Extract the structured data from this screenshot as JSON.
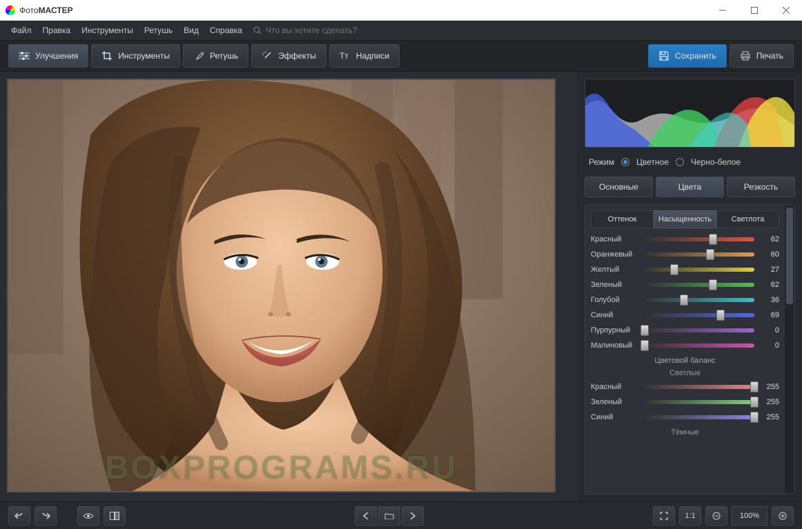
{
  "window": {
    "title_light": "Фото",
    "title_bold": "МАСТЕР"
  },
  "menu": {
    "items": [
      "Файл",
      "Правка",
      "Инструменты",
      "Ретушь",
      "Вид",
      "Справка"
    ],
    "search_placeholder": "Что вы хотите сделать?"
  },
  "toolbar": {
    "tabs": [
      {
        "label": "Улучшения",
        "icon": "sliders-icon",
        "active": true
      },
      {
        "label": "Инструменты",
        "icon": "crop-icon",
        "active": false
      },
      {
        "label": "Ретушь",
        "icon": "brush-icon",
        "active": false
      },
      {
        "label": "Эффекты",
        "icon": "wand-icon",
        "active": false
      },
      {
        "label": "Надписи",
        "icon": "text-icon",
        "active": false
      }
    ],
    "save_label": "Сохранить",
    "print_label": "Печать"
  },
  "side": {
    "mode_label": "Режим",
    "mode_color": "Цветное",
    "mode_bw": "Черно-белое",
    "tabs1": [
      {
        "label": "Основные",
        "active": false
      },
      {
        "label": "Цвета",
        "active": true
      },
      {
        "label": "Резкость",
        "active": false
      }
    ],
    "tabs2": [
      {
        "label": "Оттенок",
        "active": false
      },
      {
        "label": "Насыщенность",
        "active": true
      },
      {
        "label": "Светлота",
        "active": false
      }
    ],
    "sliders": [
      {
        "name": "Красный",
        "value": 62,
        "max": 100,
        "grad": "linear-gradient(90deg,#333,#d54)",
        "bar": "linear-gradient(90deg,#333,#e44)"
      },
      {
        "name": "Оранжевый",
        "value": 60,
        "max": 100,
        "grad": "linear-gradient(90deg,#333,#d95)",
        "bar": "linear-gradient(90deg,#333,#e85)"
      },
      {
        "name": "Желтый",
        "value": 27,
        "max": 100,
        "grad": "linear-gradient(90deg,#333,#dc4)",
        "bar": "linear-gradient(90deg,#333,#ed4)"
      },
      {
        "name": "Зеленый",
        "value": 62,
        "max": 100,
        "grad": "linear-gradient(90deg,#333,#5b5)",
        "bar": "linear-gradient(90deg,#333,#4c5)"
      },
      {
        "name": "Голубой",
        "value": 36,
        "max": 100,
        "grad": "linear-gradient(90deg,#333,#4bc)",
        "bar": "linear-gradient(90deg,#333,#3cd)"
      },
      {
        "name": "Синий",
        "value": 69,
        "max": 100,
        "grad": "linear-gradient(90deg,#333,#56d)",
        "bar": "linear-gradient(90deg,#333,#46e)"
      },
      {
        "name": "Пурпурный",
        "value": 0,
        "max": 100,
        "grad": "linear-gradient(90deg,#333,#96c)",
        "bar": "linear-gradient(90deg,#333,#a6d)"
      },
      {
        "name": "Малиновый",
        "value": 0,
        "max": 100,
        "grad": "linear-gradient(90deg,#333,#c5a)",
        "bar": "linear-gradient(90deg,#333,#d5b)"
      }
    ],
    "balance_header": "Цветовой баланс",
    "balance_light": "Светлые",
    "balance_dark": "Тёмные",
    "balance_sliders": [
      {
        "name": "Красный",
        "value": 255,
        "max": 255,
        "grad": "linear-gradient(90deg,#333,#d88)"
      },
      {
        "name": "Зеленый",
        "value": 255,
        "max": 255,
        "grad": "linear-gradient(90deg,#333,#8c8)"
      },
      {
        "name": "Синий",
        "value": 255,
        "max": 255,
        "grad": "linear-gradient(90deg,#333,#88d)"
      }
    ]
  },
  "bottom": {
    "zoom_11": "1:1",
    "zoom_pct": "100%"
  },
  "watermark": "BOXPROGRAMS.RU"
}
